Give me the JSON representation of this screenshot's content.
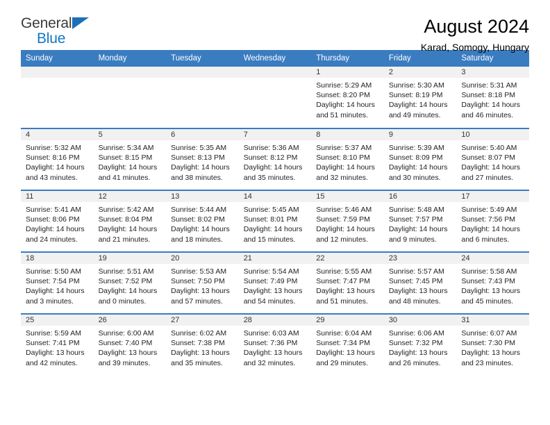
{
  "brand": {
    "name_top": "General",
    "name_bottom": "Blue",
    "color_blue": "#1277c4",
    "color_dark": "#3a3a3a"
  },
  "header": {
    "title": "August 2024",
    "subtitle": "Karad, Somogy, Hungary"
  },
  "theme": {
    "header_blue": "#3a7cc0",
    "band_gray": "#f1f1f1"
  },
  "weekdays": [
    "Sunday",
    "Monday",
    "Tuesday",
    "Wednesday",
    "Thursday",
    "Friday",
    "Saturday"
  ],
  "labels": {
    "sunrise": "Sunrise:",
    "sunset": "Sunset:",
    "daylight": "Daylight:"
  },
  "weeks": [
    [
      {
        "day": "",
        "empty": true
      },
      {
        "day": "",
        "empty": true
      },
      {
        "day": "",
        "empty": true
      },
      {
        "day": "",
        "empty": true
      },
      {
        "day": "1",
        "sunrise": "Sunrise: 5:29 AM",
        "sunset": "Sunset: 8:20 PM",
        "daylight1": "Daylight: 14 hours",
        "daylight2": "and 51 minutes."
      },
      {
        "day": "2",
        "sunrise": "Sunrise: 5:30 AM",
        "sunset": "Sunset: 8:19 PM",
        "daylight1": "Daylight: 14 hours",
        "daylight2": "and 49 minutes."
      },
      {
        "day": "3",
        "sunrise": "Sunrise: 5:31 AM",
        "sunset": "Sunset: 8:18 PM",
        "daylight1": "Daylight: 14 hours",
        "daylight2": "and 46 minutes."
      }
    ],
    [
      {
        "day": "4",
        "sunrise": "Sunrise: 5:32 AM",
        "sunset": "Sunset: 8:16 PM",
        "daylight1": "Daylight: 14 hours",
        "daylight2": "and 43 minutes."
      },
      {
        "day": "5",
        "sunrise": "Sunrise: 5:34 AM",
        "sunset": "Sunset: 8:15 PM",
        "daylight1": "Daylight: 14 hours",
        "daylight2": "and 41 minutes."
      },
      {
        "day": "6",
        "sunrise": "Sunrise: 5:35 AM",
        "sunset": "Sunset: 8:13 PM",
        "daylight1": "Daylight: 14 hours",
        "daylight2": "and 38 minutes."
      },
      {
        "day": "7",
        "sunrise": "Sunrise: 5:36 AM",
        "sunset": "Sunset: 8:12 PM",
        "daylight1": "Daylight: 14 hours",
        "daylight2": "and 35 minutes."
      },
      {
        "day": "8",
        "sunrise": "Sunrise: 5:37 AM",
        "sunset": "Sunset: 8:10 PM",
        "daylight1": "Daylight: 14 hours",
        "daylight2": "and 32 minutes."
      },
      {
        "day": "9",
        "sunrise": "Sunrise: 5:39 AM",
        "sunset": "Sunset: 8:09 PM",
        "daylight1": "Daylight: 14 hours",
        "daylight2": "and 30 minutes."
      },
      {
        "day": "10",
        "sunrise": "Sunrise: 5:40 AM",
        "sunset": "Sunset: 8:07 PM",
        "daylight1": "Daylight: 14 hours",
        "daylight2": "and 27 minutes."
      }
    ],
    [
      {
        "day": "11",
        "sunrise": "Sunrise: 5:41 AM",
        "sunset": "Sunset: 8:06 PM",
        "daylight1": "Daylight: 14 hours",
        "daylight2": "and 24 minutes."
      },
      {
        "day": "12",
        "sunrise": "Sunrise: 5:42 AM",
        "sunset": "Sunset: 8:04 PM",
        "daylight1": "Daylight: 14 hours",
        "daylight2": "and 21 minutes."
      },
      {
        "day": "13",
        "sunrise": "Sunrise: 5:44 AM",
        "sunset": "Sunset: 8:02 PM",
        "daylight1": "Daylight: 14 hours",
        "daylight2": "and 18 minutes."
      },
      {
        "day": "14",
        "sunrise": "Sunrise: 5:45 AM",
        "sunset": "Sunset: 8:01 PM",
        "daylight1": "Daylight: 14 hours",
        "daylight2": "and 15 minutes."
      },
      {
        "day": "15",
        "sunrise": "Sunrise: 5:46 AM",
        "sunset": "Sunset: 7:59 PM",
        "daylight1": "Daylight: 14 hours",
        "daylight2": "and 12 minutes."
      },
      {
        "day": "16",
        "sunrise": "Sunrise: 5:48 AM",
        "sunset": "Sunset: 7:57 PM",
        "daylight1": "Daylight: 14 hours",
        "daylight2": "and 9 minutes."
      },
      {
        "day": "17",
        "sunrise": "Sunrise: 5:49 AM",
        "sunset": "Sunset: 7:56 PM",
        "daylight1": "Daylight: 14 hours",
        "daylight2": "and 6 minutes."
      }
    ],
    [
      {
        "day": "18",
        "sunrise": "Sunrise: 5:50 AM",
        "sunset": "Sunset: 7:54 PM",
        "daylight1": "Daylight: 14 hours",
        "daylight2": "and 3 minutes."
      },
      {
        "day": "19",
        "sunrise": "Sunrise: 5:51 AM",
        "sunset": "Sunset: 7:52 PM",
        "daylight1": "Daylight: 14 hours",
        "daylight2": "and 0 minutes."
      },
      {
        "day": "20",
        "sunrise": "Sunrise: 5:53 AM",
        "sunset": "Sunset: 7:50 PM",
        "daylight1": "Daylight: 13 hours",
        "daylight2": "and 57 minutes."
      },
      {
        "day": "21",
        "sunrise": "Sunrise: 5:54 AM",
        "sunset": "Sunset: 7:49 PM",
        "daylight1": "Daylight: 13 hours",
        "daylight2": "and 54 minutes."
      },
      {
        "day": "22",
        "sunrise": "Sunrise: 5:55 AM",
        "sunset": "Sunset: 7:47 PM",
        "daylight1": "Daylight: 13 hours",
        "daylight2": "and 51 minutes."
      },
      {
        "day": "23",
        "sunrise": "Sunrise: 5:57 AM",
        "sunset": "Sunset: 7:45 PM",
        "daylight1": "Daylight: 13 hours",
        "daylight2": "and 48 minutes."
      },
      {
        "day": "24",
        "sunrise": "Sunrise: 5:58 AM",
        "sunset": "Sunset: 7:43 PM",
        "daylight1": "Daylight: 13 hours",
        "daylight2": "and 45 minutes."
      }
    ],
    [
      {
        "day": "25",
        "sunrise": "Sunrise: 5:59 AM",
        "sunset": "Sunset: 7:41 PM",
        "daylight1": "Daylight: 13 hours",
        "daylight2": "and 42 minutes."
      },
      {
        "day": "26",
        "sunrise": "Sunrise: 6:00 AM",
        "sunset": "Sunset: 7:40 PM",
        "daylight1": "Daylight: 13 hours",
        "daylight2": "and 39 minutes."
      },
      {
        "day": "27",
        "sunrise": "Sunrise: 6:02 AM",
        "sunset": "Sunset: 7:38 PM",
        "daylight1": "Daylight: 13 hours",
        "daylight2": "and 35 minutes."
      },
      {
        "day": "28",
        "sunrise": "Sunrise: 6:03 AM",
        "sunset": "Sunset: 7:36 PM",
        "daylight1": "Daylight: 13 hours",
        "daylight2": "and 32 minutes."
      },
      {
        "day": "29",
        "sunrise": "Sunrise: 6:04 AM",
        "sunset": "Sunset: 7:34 PM",
        "daylight1": "Daylight: 13 hours",
        "daylight2": "and 29 minutes."
      },
      {
        "day": "30",
        "sunrise": "Sunrise: 6:06 AM",
        "sunset": "Sunset: 7:32 PM",
        "daylight1": "Daylight: 13 hours",
        "daylight2": "and 26 minutes."
      },
      {
        "day": "31",
        "sunrise": "Sunrise: 6:07 AM",
        "sunset": "Sunset: 7:30 PM",
        "daylight1": "Daylight: 13 hours",
        "daylight2": "and 23 minutes."
      }
    ]
  ]
}
